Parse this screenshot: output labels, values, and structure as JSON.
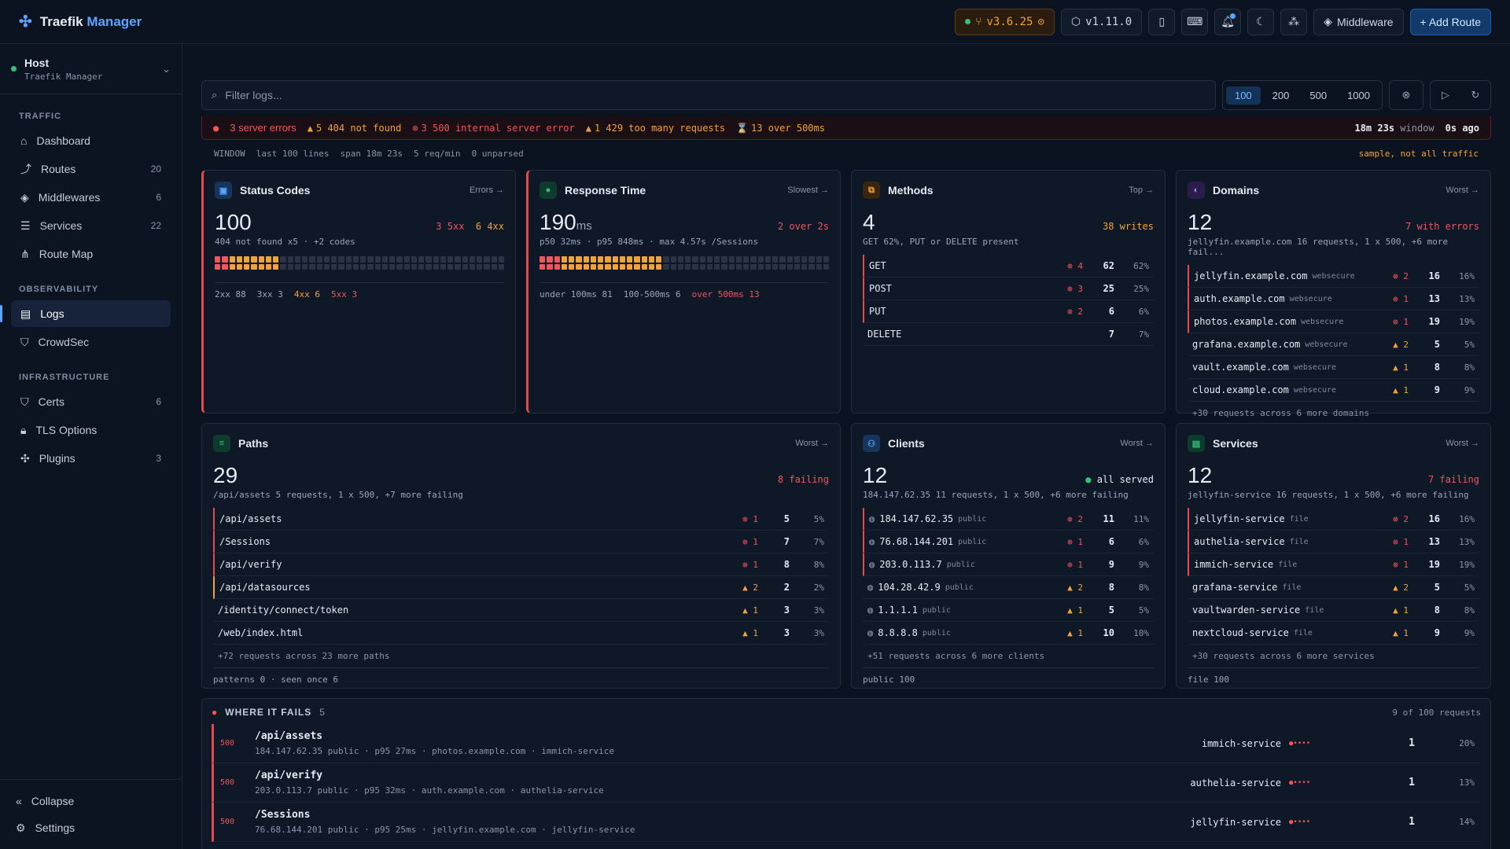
{
  "app": {
    "title1": "Traefik",
    "title2": "Manager"
  },
  "topbar": {
    "version": "v3.6.25",
    "manager_version": "v1.11.0",
    "middleware": "Middleware",
    "add_route": "+ Add Route"
  },
  "host": {
    "name": "Host",
    "sub": "Traefik Manager"
  },
  "nav": {
    "traffic": "TRAFFIC",
    "observability": "OBSERVABILITY",
    "infrastructure": "INFRASTRUCTURE",
    "items": [
      {
        "label": "Dashboard",
        "count": ""
      },
      {
        "label": "Routes",
        "count": "20"
      },
      {
        "label": "Middlewares",
        "count": "6"
      },
      {
        "label": "Services",
        "count": "22"
      },
      {
        "label": "Route Map",
        "count": ""
      },
      {
        "label": "Logs",
        "count": ""
      },
      {
        "label": "CrowdSec",
        "count": ""
      },
      {
        "label": "Certs",
        "count": "6"
      },
      {
        "label": "TLS Options",
        "count": ""
      },
      {
        "label": "Plugins",
        "count": "3"
      }
    ],
    "collapse": "Collapse",
    "settings": "Settings"
  },
  "filter": {
    "placeholder": "Filter logs...",
    "sizes": [
      "100",
      "200",
      "500",
      "1000"
    ]
  },
  "errbar": {
    "main": "3 server errors",
    "a": "5 404 not found",
    "b": "3 500 internal server error",
    "c": "1 429 too many requests",
    "d": "13 over 500ms",
    "window": "18m 23s",
    "window_label": "window",
    "ago": "0s ago"
  },
  "winbar": {
    "label": "WINDOW",
    "lines": "last 100 lines",
    "span": "span 18m 23s",
    "rate": "5 req/min",
    "unparsed": "0 unparsed",
    "note": "sample, not all traffic"
  },
  "status": {
    "title": "Status Codes",
    "link": "Errors →",
    "value": "100",
    "badge5": "3 5xx",
    "badge4": "6 4xx",
    "sub": "404 not found x5 · +2 codes",
    "foot": [
      "2xx 88",
      "3xx 3",
      "4xx 6",
      "5xx 3"
    ]
  },
  "resp": {
    "title": "Response Time",
    "link": "Slowest →",
    "value": "190",
    "unit": "ms",
    "badge": "2 over 2s",
    "sub": "p50 32ms · p95 848ms · max 4.57s /Sessions",
    "foot": [
      "under 100ms 81",
      "100-500ms 6",
      "over 500ms 13"
    ]
  },
  "methods": {
    "title": "Methods",
    "link": "Top →",
    "value": "4",
    "badge": "38 writes",
    "sub": "GET 62%, PUT or DELETE present",
    "rows": [
      {
        "name": "GET",
        "err": "4",
        "n": "62",
        "p": "62%"
      },
      {
        "name": "POST",
        "err": "3",
        "n": "25",
        "p": "25%"
      },
      {
        "name": "PUT",
        "err": "2",
        "n": "6",
        "p": "6%"
      },
      {
        "name": "DELETE",
        "err": "",
        "n": "7",
        "p": "7%"
      }
    ]
  },
  "domains": {
    "title": "Domains",
    "link": "Worst →",
    "value": "12",
    "badge": "7 with errors",
    "sub": "jellyfin.example.com 16 requests, 1 x 500, +6 more fail...",
    "rows": [
      {
        "name": "jellyfin.example.com",
        "tag": "websecure",
        "err": "2",
        "n": "16",
        "p": "16%"
      },
      {
        "name": "auth.example.com",
        "tag": "websecure",
        "err": "1",
        "n": "13",
        "p": "13%"
      },
      {
        "name": "photos.example.com",
        "tag": "websecure",
        "err": "1",
        "n": "19",
        "p": "19%"
      },
      {
        "name": "grafana.example.com",
        "tag": "websecure",
        "err": "2",
        "n": "5",
        "p": "5%"
      },
      {
        "name": "vault.example.com",
        "tag": "websecure",
        "err": "1",
        "n": "8",
        "p": "8%"
      },
      {
        "name": "cloud.example.com",
        "tag": "websecure",
        "err": "1",
        "n": "9",
        "p": "9%"
      }
    ],
    "more": "+30 requests across 6 more domains"
  },
  "paths": {
    "title": "Paths",
    "link": "Worst →",
    "value": "29",
    "badge": "8 failing",
    "sub": "/api/assets 5 requests, 1 x 500, +7 more failing",
    "rows": [
      {
        "name": "/api/assets",
        "err": "1",
        "n": "5",
        "p": "5%"
      },
      {
        "name": "/Sessions",
        "err": "1",
        "n": "7",
        "p": "7%"
      },
      {
        "name": "/api/verify",
        "err": "1",
        "n": "8",
        "p": "8%"
      },
      {
        "name": "/api/datasources",
        "err": "2",
        "n": "2",
        "p": "2%"
      },
      {
        "name": "/identity/connect/token",
        "err": "1",
        "n": "3",
        "p": "3%"
      },
      {
        "name": "/web/index.html",
        "err": "1",
        "n": "3",
        "p": "3%"
      }
    ],
    "more": "+72 requests across 23 more paths",
    "foot": "patterns 0 · seen once 6"
  },
  "clients": {
    "title": "Clients",
    "link": "Worst →",
    "value": "12",
    "badge": "all served",
    "sub": "184.147.62.35 11 requests, 1 x 500, +6 more failing",
    "rows": [
      {
        "name": "184.147.62.35",
        "tag": "public",
        "err": "2",
        "n": "11",
        "p": "11%"
      },
      {
        "name": "76.68.144.201",
        "tag": "public",
        "err": "1",
        "n": "6",
        "p": "6%"
      },
      {
        "name": "203.0.113.7",
        "tag": "public",
        "err": "1",
        "n": "9",
        "p": "9%"
      },
      {
        "name": "104.28.42.9",
        "tag": "public",
        "err": "2",
        "n": "8",
        "p": "8%"
      },
      {
        "name": "1.1.1.1",
        "tag": "public",
        "err": "1",
        "n": "5",
        "p": "5%"
      },
      {
        "name": "8.8.8.8",
        "tag": "public",
        "err": "1",
        "n": "10",
        "p": "10%"
      }
    ],
    "more": "+51 requests across 6 more clients",
    "foot": "public 100"
  },
  "services": {
    "title": "Services",
    "link": "Worst →",
    "value": "12",
    "badge": "7 failing",
    "sub": "jellyfin-service 16 requests, 1 x 500, +6 more failing",
    "rows": [
      {
        "name": "jellyfin-service",
        "tag": "file",
        "err": "2",
        "n": "16",
        "p": "16%"
      },
      {
        "name": "authelia-service",
        "tag": "file",
        "err": "1",
        "n": "13",
        "p": "13%"
      },
      {
        "name": "immich-service",
        "tag": "file",
        "err": "1",
        "n": "19",
        "p": "19%"
      },
      {
        "name": "grafana-service",
        "tag": "file",
        "err": "2",
        "n": "5",
        "p": "5%"
      },
      {
        "name": "vaultwarden-service",
        "tag": "file",
        "err": "1",
        "n": "8",
        "p": "8%"
      },
      {
        "name": "nextcloud-service",
        "tag": "file",
        "err": "1",
        "n": "9",
        "p": "9%"
      }
    ],
    "more": "+30 requests across 6 more services",
    "foot": "file 100"
  },
  "fails": {
    "title": "WHERE IT FAILS",
    "count": "5",
    "right": "9 of 100 requests",
    "rows": [
      {
        "code": "500",
        "path": "/api/assets",
        "meta": "184.147.62.35 public · p95 27ms · photos.example.com · immich-service",
        "svc": "immich-service",
        "n": "1",
        "p": "20%"
      },
      {
        "code": "500",
        "path": "/api/verify",
        "meta": "203.0.113.7 public · p95 32ms · auth.example.com · authelia-service",
        "svc": "authelia-service",
        "n": "1",
        "p": "13%"
      },
      {
        "code": "500",
        "path": "/Sessions",
        "meta": "76.68.144.201 public · p95 25ms · jellyfin.example.com · jellyfin-service",
        "svc": "jellyfin-service",
        "n": "1",
        "p": "14%"
      }
    ]
  }
}
